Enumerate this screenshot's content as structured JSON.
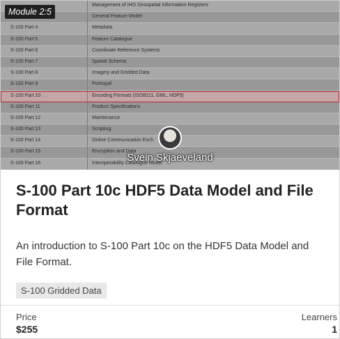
{
  "module_badge": "Module 2:5",
  "thumbnail_rows": [
    {
      "part": "",
      "desc": "Management of IHO Geospatial Information Registers"
    },
    {
      "part": "",
      "desc": "General Feature Model"
    },
    {
      "part": "S-100 Part 4",
      "desc": "Metadata"
    },
    {
      "part": "S-100 Part 5",
      "desc": "Feature Catalogue"
    },
    {
      "part": "S-100 Part 6",
      "desc": "Coordinate Reference Systems"
    },
    {
      "part": "S-100 Part 7",
      "desc": "Spatial Schema"
    },
    {
      "part": "S-100 Part 8",
      "desc": "Imagery and Gridded Data"
    },
    {
      "part": "S-100 Part 9",
      "desc": "Portrayal"
    },
    {
      "part": "S-100 Part 10",
      "desc": "Encoding Formats (ISO8211, GML, HDF5)"
    },
    {
      "part": "S-100 Part 11",
      "desc": "Product Specifications"
    },
    {
      "part": "S-100 Part 12",
      "desc": "Maintenance"
    },
    {
      "part": "S-100 Part 13",
      "desc": "Scripting"
    },
    {
      "part": "S-100 Part 14",
      "desc": "Online Communication Exch"
    },
    {
      "part": "S-100 Part 15",
      "desc": "Encryption and Data"
    },
    {
      "part": "S-100 Part 16",
      "desc": "Interoperability Catalogue Model"
    }
  ],
  "highlighted_row": 8,
  "author": "Svein Skjaeveland",
  "course_title": "S-100 Part 10c HDF5 Data Model and File Format",
  "course_description": "An introduction to S-100 Part 10c on the HDF5 Data Model and File Format.",
  "tag": "S-100 Gridded Data",
  "price_label": "Price",
  "price_value": "$255",
  "learners_label": "Learners",
  "learners_value": "1",
  "colors": {
    "highlight_border": "#b3262f"
  }
}
